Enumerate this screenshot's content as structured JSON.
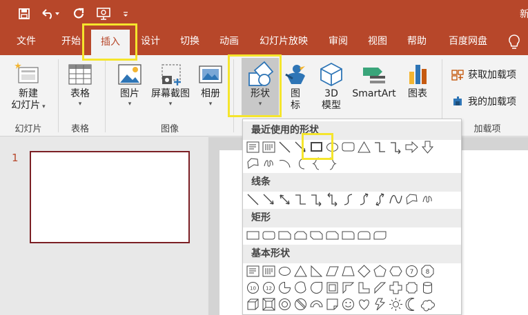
{
  "titlebar": {
    "title_fragment": "新",
    "icons": [
      "save-icon",
      "undo-icon",
      "redo-icon",
      "present-icon",
      "customize-quick-access-icon"
    ]
  },
  "tabs": [
    {
      "label": "文件",
      "active": false
    },
    {
      "label": "开始",
      "active": false
    },
    {
      "label": "插入",
      "active": true
    },
    {
      "label": "设计",
      "active": false
    },
    {
      "label": "切换",
      "active": false
    },
    {
      "label": "动画",
      "active": false
    },
    {
      "label": "幻灯片放映",
      "active": false
    },
    {
      "label": "审阅",
      "active": false
    },
    {
      "label": "视图",
      "active": false
    },
    {
      "label": "帮助",
      "active": false
    },
    {
      "label": "百度网盘",
      "active": false
    }
  ],
  "ribbon": {
    "new_slide": {
      "line1": "新建",
      "line2": "幻灯片"
    },
    "table": "表格",
    "picture": "图片",
    "screenshot": "屏幕截图",
    "album": "相册",
    "shapes": "形状",
    "icons": "图标",
    "threed": {
      "line1": "3D",
      "line2": "模型"
    },
    "smartart": "SmartArt",
    "chart": "图表",
    "get_addins": "获取加载项",
    "my_addins": "我的加载项",
    "groups": {
      "slides": "幻灯片",
      "tables": "表格",
      "images": "图像",
      "addins": "加载项"
    }
  },
  "slides_pane": {
    "slide_number": "1"
  },
  "shapes_menu": {
    "sections": [
      {
        "title": "最近使用的形状"
      },
      {
        "title": "线条"
      },
      {
        "title": "矩形"
      },
      {
        "title": "基本形状"
      }
    ]
  },
  "colors": {
    "accent": "#b7472a",
    "highlight": "#f5e52c",
    "thumb_border": "#7b1f24"
  }
}
